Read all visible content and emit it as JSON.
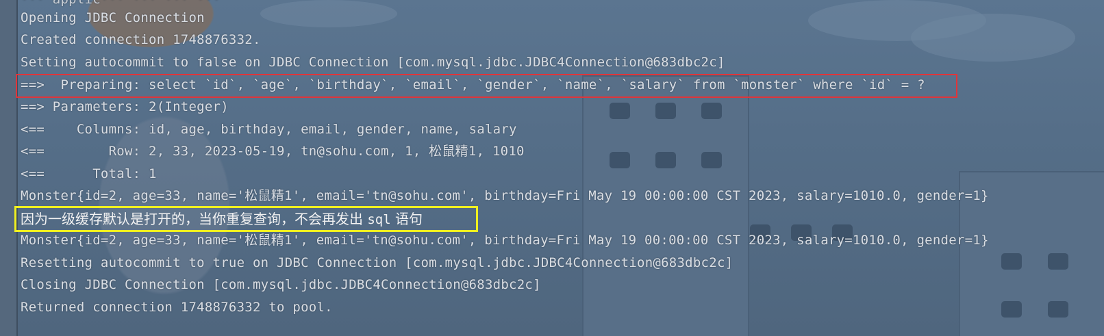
{
  "console": {
    "partial_top_line": "··· applic··· ··· ··· ···",
    "lines": [
      "Opening JDBC Connection",
      "Created connection 1748876332.",
      "Setting autocommit to false on JDBC Connection [com.mysql.jdbc.JDBC4Connection@683dbc2c]",
      "==>  Preparing: select `id`, `age`, `birthday`, `email`, `gender`, `name`, `salary` from `monster` where `id` = ?",
      "==> Parameters: 2(Integer)",
      "<==    Columns: id, age, birthday, email, gender, name, salary",
      "<==        Row: 2, 33, 2023-05-19, tn@sohu.com, 1, 松鼠精1, 1010",
      "<==      Total: 1",
      "Monster{id=2, age=33, name='松鼠精1', email='tn@sohu.com', birthday=Fri May 19 00:00:00 CST 2023, salary=1010.0, gender=1}",
      "Monster{id=2, age=33, name='松鼠精1', email='tn@sohu.com', birthday=Fri May 19 00:00:00 CST 2023, salary=1010.0, gender=1}",
      "Resetting autocommit to true on JDBC Connection [com.mysql.jdbc.JDBC4Connection@683dbc2c]",
      "Closing JDBC Connection [com.mysql.jdbc.JDBC4Connection@683dbc2c]",
      "Returned connection 1748876332 to pool."
    ],
    "annotation": {
      "text_cn": "因为一级缓存默认是打开的，当你重复查询，不会再发出 ",
      "text_code": "sql",
      "text_cn_tail": " 语句"
    }
  },
  "colors": {
    "highlight_red": "#e0353a",
    "highlight_yellow": "#f0f020",
    "text": "#d9dde3"
  }
}
